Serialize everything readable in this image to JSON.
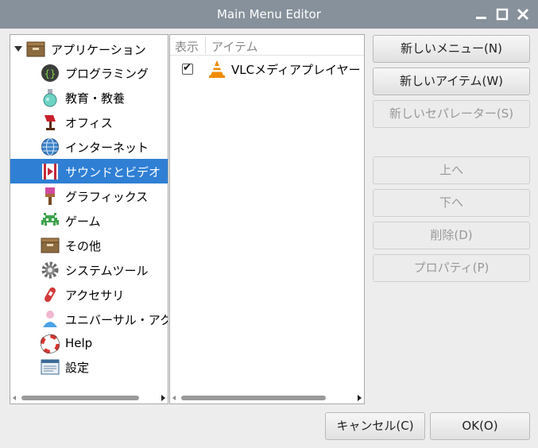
{
  "window": {
    "title": "Main Menu Editor"
  },
  "tree": {
    "root": {
      "label": "アプリケーション"
    },
    "items": [
      {
        "label": "プログラミング",
        "icon": "programming-icon"
      },
      {
        "label": "教育・教養",
        "icon": "education-icon"
      },
      {
        "label": "オフィス",
        "icon": "office-icon"
      },
      {
        "label": "インターネット",
        "icon": "internet-icon"
      },
      {
        "label": "サウンドとビデオ",
        "icon": "sound-video-icon",
        "selected": true
      },
      {
        "label": "グラフィックス",
        "icon": "graphics-icon"
      },
      {
        "label": "ゲーム",
        "icon": "game-icon"
      },
      {
        "label": "その他",
        "icon": "other-icon"
      },
      {
        "label": "システムツール",
        "icon": "system-tools-icon"
      },
      {
        "label": "アクセサリ",
        "icon": "accessories-icon"
      },
      {
        "label": "ユニバーサル・アクセス",
        "icon": "universal-access-icon"
      },
      {
        "label": "Help",
        "icon": "help-icon"
      },
      {
        "label": "設定",
        "icon": "settings-icon"
      }
    ]
  },
  "items_list": {
    "columns": {
      "show": "表示",
      "item": "アイテム"
    },
    "rows": [
      {
        "checked": true,
        "label": "VLCメディアプレイヤー",
        "icon": "vlc-icon"
      }
    ]
  },
  "buttons": {
    "new_menu": "新しいメニュー(N)",
    "new_item": "新しいアイテム(W)",
    "new_separator": "新しいセパレーター(S)",
    "move_up": "上へ",
    "move_down": "下へ",
    "delete": "削除(D)",
    "properties": "プロパティ(P)",
    "cancel": "キャンセル(C)",
    "ok": "OK(O)"
  },
  "colors": {
    "titlebar": "#87919b",
    "selection": "#2f7fd4"
  }
}
